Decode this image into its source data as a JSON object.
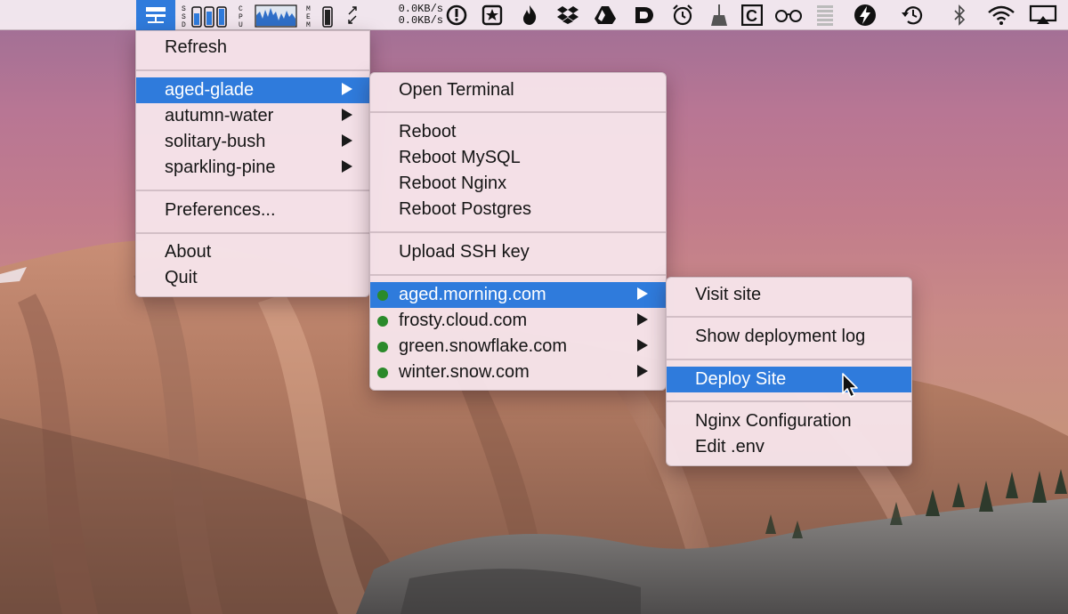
{
  "menubar": {
    "net_up": "0.0KB/s",
    "net_down": "0.0KB/s",
    "icons": [
      "server-menu-icon",
      "ssd-monitor-icon",
      "cpu-monitor-icon",
      "memory-monitor-icon",
      "network-arrows-icon",
      "clock-app-icon",
      "star-app-icon",
      "flame-app-icon",
      "dropbox-icon",
      "google-drive-icon",
      "d-app-icon",
      "alarm-clock-icon",
      "broom-icon",
      "c-app-icon",
      "glasses-icon",
      "battery-bars-icon",
      "lightning-icon",
      "time-machine-icon",
      "bluetooth-icon",
      "wifi-icon",
      "airplay-icon"
    ]
  },
  "menu_main": {
    "refresh": "Refresh",
    "servers": [
      {
        "label": "aged-glade"
      },
      {
        "label": "autumn-water"
      },
      {
        "label": "solitary-bush"
      },
      {
        "label": "sparkling-pine"
      }
    ],
    "preferences": "Preferences...",
    "about": "About",
    "quit": "Quit"
  },
  "menu_server": {
    "open_terminal": "Open Terminal",
    "reboot": "Reboot",
    "reboot_mysql": "Reboot MySQL",
    "reboot_nginx": "Reboot Nginx",
    "reboot_postgres": "Reboot Postgres",
    "upload_ssh_key": "Upload SSH key",
    "sites": [
      {
        "label": "aged.morning.com"
      },
      {
        "label": "frosty.cloud.com"
      },
      {
        "label": "green.snowflake.com"
      },
      {
        "label": "winter.snow.com"
      }
    ],
    "site_status_color": "#2a8a2a"
  },
  "menu_site": {
    "visit_site": "Visit site",
    "show_deployment_log": "Show deployment log",
    "deploy_site": "Deploy Site",
    "nginx_configuration": "Nginx Configuration",
    "edit_env": "Edit .env"
  },
  "colors": {
    "highlight": "#2f7bdc",
    "menu_bg": "#f6e4ea"
  }
}
